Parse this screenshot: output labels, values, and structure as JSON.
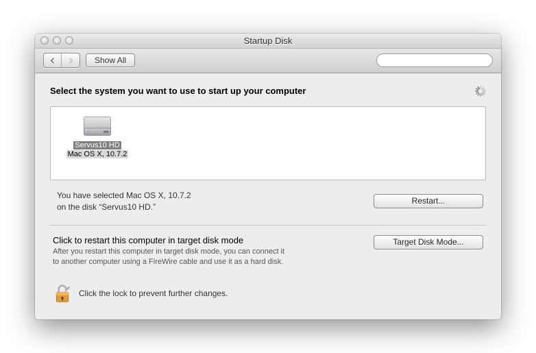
{
  "window": {
    "title": "Startup Disk"
  },
  "toolbar": {
    "show_all": "Show All",
    "search_placeholder": ""
  },
  "heading": "Select the system you want to use to start up your computer",
  "disks": [
    {
      "name": "Servus10 HD",
      "system": "Mac OS X, 10.7.2"
    }
  ],
  "status": {
    "line1": "You have selected Mac OS X, 10.7.2",
    "line2": "on the disk “Servus10 HD.”"
  },
  "buttons": {
    "restart": "Restart...",
    "target_disk_mode": "Target Disk Mode..."
  },
  "target": {
    "title": "Click to restart this computer in target disk mode",
    "desc1": "After you restart this computer in target disk mode, you can connect it",
    "desc2": "to another computer using a FireWire cable and use it as a hard disk."
  },
  "lock": {
    "text": "Click the lock to prevent further changes."
  }
}
